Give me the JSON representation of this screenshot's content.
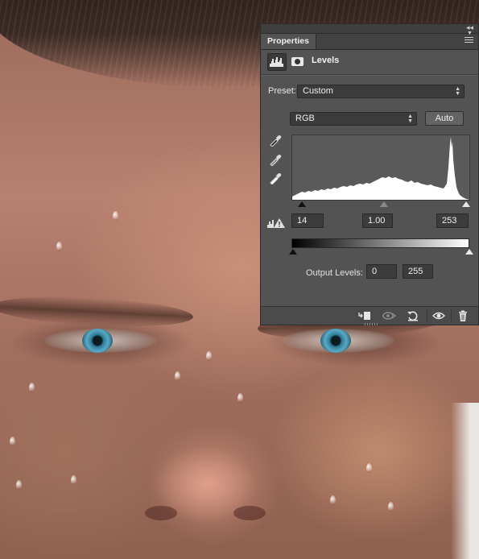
{
  "panel": {
    "tab_label": "Properties",
    "title": "Levels",
    "preset_label": "Preset:",
    "preset_value": "Custom",
    "channel_value": "RGB",
    "auto_label": "Auto",
    "input_black": "14",
    "input_gamma": "1.00",
    "input_white": "253",
    "output_label": "Output Levels:",
    "output_black": "0",
    "output_white": "255"
  },
  "icons": {
    "collapse": "double-chevron-right-icon",
    "panel_menu": "panel-menu-icon",
    "adjustment": "levels-histogram-icon",
    "mask": "layer-mask-icon",
    "black_point": "black-point-eyedropper-icon",
    "gray_point": "gray-point-eyedropper-icon",
    "white_point": "white-point-eyedropper-icon",
    "clipping_warning": "clipping-warning-icon",
    "footer": [
      "clip-to-layer-icon",
      "view-previous-state-icon",
      "reset-icon",
      "visibility-eye-icon",
      "trash-icon"
    ]
  },
  "colors": {
    "panel_bg": "#535353",
    "field_bg": "#3c3c3c",
    "text": "#e6e6e6"
  }
}
